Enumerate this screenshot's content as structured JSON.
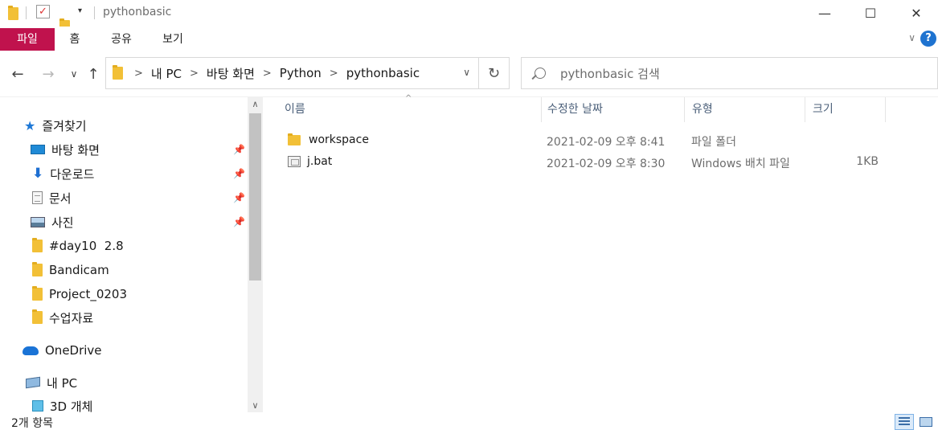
{
  "window": {
    "title": "pythonbasic",
    "minimize_glyph": "—",
    "maximize_glyph": "☐",
    "close_glyph": "✕"
  },
  "ribbon": {
    "tabs": [
      "파일",
      "홈",
      "공유",
      "보기"
    ],
    "help_glyph": "?",
    "collapse_glyph": "∨"
  },
  "navigation": {
    "back_glyph": "←",
    "forward_glyph": "→",
    "recent_glyph": "∨",
    "up_glyph": "↑",
    "breadcrumb": [
      "내 PC",
      "바탕 화면",
      "Python",
      "pythonbasic"
    ],
    "crumb_sep": ">",
    "dropdown_glyph": "∨",
    "refresh_glyph": "↻",
    "search_placeholder": "pythonbasic 검색"
  },
  "nav_pane": {
    "quick_access": "즐겨찾기",
    "pinned": [
      {
        "label": "바탕 화면",
        "icon": "desktop-icon"
      },
      {
        "label": "다운로드",
        "icon": "download-icon"
      },
      {
        "label": "문서",
        "icon": "document-icon"
      },
      {
        "label": "사진",
        "icon": "pictures-icon"
      }
    ],
    "folders": [
      "#day10  2.8",
      "Bandicam",
      "Project_0203",
      "수업자료"
    ],
    "onedrive": "OneDrive",
    "this_pc": "내 PC",
    "objects_3d": "3D 개체",
    "pin_glyph": "📌",
    "scroll_up": "∧",
    "scroll_down": "∨"
  },
  "columns": {
    "name": "이름",
    "modified": "수정한 날짜",
    "type": "유형",
    "size": "크기",
    "sort_glyph": "^"
  },
  "files": [
    {
      "name": "workspace",
      "modified": "2021-02-09 오후 8:41",
      "type": "파일 폴더",
      "size": "",
      "icon": "folder-icon"
    },
    {
      "name": "j.bat",
      "modified": "2021-02-09 오후 8:30",
      "type": "Windows 배치 파일",
      "size": "1KB",
      "icon": "batch-file-icon"
    }
  ],
  "status": {
    "item_count": "2개 항목"
  },
  "colors": {
    "file_tab": "#c0124d",
    "accent": "#1e73d0",
    "folder": "#f2c037"
  }
}
